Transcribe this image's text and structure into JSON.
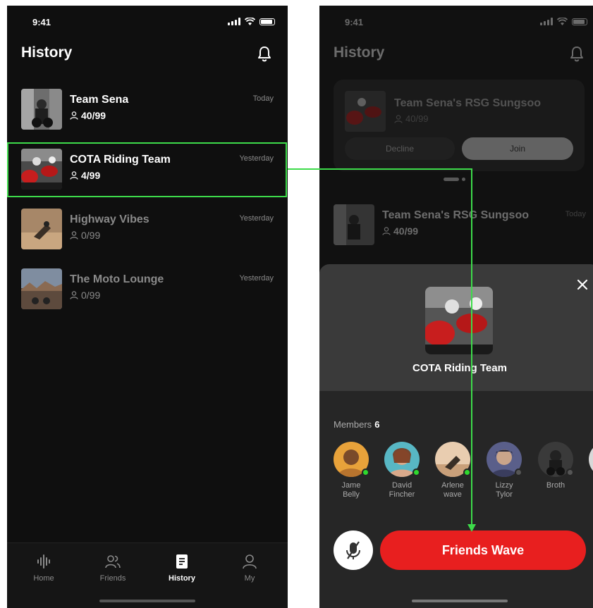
{
  "status": {
    "time": "9:41"
  },
  "history_screen": {
    "title": "History",
    "rows": [
      {
        "name": "Team Sena",
        "count": "40/99",
        "date": "Today"
      },
      {
        "name": "COTA Riding Team",
        "count": "4/99",
        "date": "Yesterday"
      },
      {
        "name": "Highway Vibes",
        "count": "0/99",
        "date": "Yesterday"
      },
      {
        "name": "The Moto Lounge",
        "count": "0/99",
        "date": "Yesterday"
      }
    ],
    "tabs": [
      {
        "label": "Home",
        "icon": "waveform-icon"
      },
      {
        "label": "Friends",
        "icon": "friends-icon"
      },
      {
        "label": "History",
        "icon": "document-icon"
      },
      {
        "label": "My",
        "icon": "person-icon"
      }
    ],
    "active_tab": "History"
  },
  "group_screen": {
    "title": "History",
    "invite": {
      "name": "Team Sena's RSG Sungsoo",
      "count": "40/99",
      "decline_label": "Decline",
      "join_label": "Join"
    },
    "history_row": {
      "name": "Team Sena's RSG Sungsoo",
      "count": "40/99",
      "date": "Today"
    },
    "sheet": {
      "group_name": "COTA Riding Team",
      "members_label": "Members",
      "members_count": "6",
      "members": [
        {
          "first": "Jame",
          "last": "Belly",
          "online": true
        },
        {
          "first": "David",
          "last": "Fincher",
          "online": true
        },
        {
          "first": "Arlene",
          "last": "wave",
          "online": true
        },
        {
          "first": "Lizzy",
          "last": "Tylor",
          "online": false
        },
        {
          "first": "Broth",
          "last": "",
          "online": false
        }
      ],
      "wave_label": "Friends Wave"
    }
  },
  "colors": {
    "accent_red": "#e81f1f",
    "highlight_green": "#3ddb4a",
    "online_green": "#2ed82e"
  }
}
